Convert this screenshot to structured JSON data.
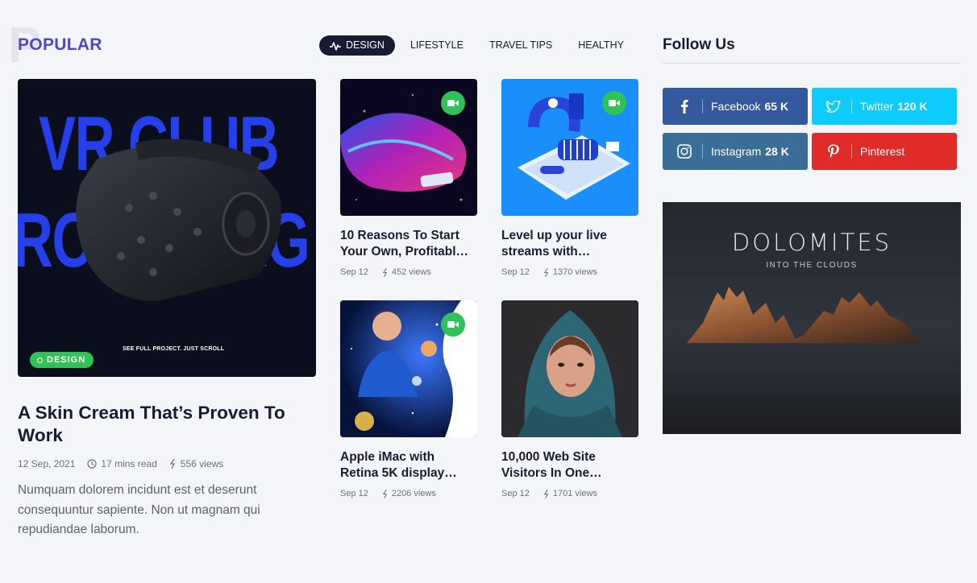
{
  "section": {
    "bg_letter": "P",
    "title": "POPULAR"
  },
  "tabs": [
    {
      "label": "DESIGN",
      "active": true
    },
    {
      "label": "LIFESTYLE",
      "active": false
    },
    {
      "label": "TRAVEL TIPS",
      "active": false
    },
    {
      "label": "HEALTHY",
      "active": false
    }
  ],
  "featured": {
    "image_text_line1": "VR CLUB",
    "image_text_line2": "ROMO PAG",
    "image_caption": "SEE FULL PROJECT. JUST SCROLL",
    "category": "DESIGN",
    "title": "A Skin Cream That’s Proven To Work",
    "date": "12 Sep, 2021",
    "read_time": "17 mins read",
    "views": "556 views",
    "excerpt": "Numquam dolorem incidunt est et deserunt consequuntur sapiente. Non ut magnam qui repudiandae laborum."
  },
  "cards": [
    {
      "title_line1": "10 Reasons To Start",
      "title_line2": "Your Own, Profitabl…",
      "date": "Sep 12",
      "views": "452 views"
    },
    {
      "title_line1": "Level up your live",
      "title_line2": "streams with…",
      "date": "Sep 12",
      "views": "1370 views"
    },
    {
      "title_line1": "Apple iMac with",
      "title_line2": "Retina 5K display…",
      "date": "Sep 12",
      "views": "2206 views"
    },
    {
      "title_line1": "10,000 Web Site",
      "title_line2": "Visitors In One…",
      "date": "Sep 12",
      "views": "1701 views"
    }
  ],
  "follow": {
    "title": "Follow Us",
    "networks": [
      {
        "name": "Facebook",
        "count": "65 K",
        "color": "#35599e",
        "icon": "facebook-icon"
      },
      {
        "name": "Twitter",
        "count": "120 K",
        "color": "#0dcbfc",
        "icon": "twitter-icon"
      },
      {
        "name": "Instagram",
        "count": "28 K",
        "color": "#3b6e96",
        "icon": "instagram-icon"
      },
      {
        "name": "Pinterest",
        "count": "",
        "color": "#e12b28",
        "icon": "pinterest-icon"
      }
    ]
  },
  "ad": {
    "title": "DOLOMITES",
    "subtitle": "INTO THE CLOUDS"
  },
  "colors": {
    "accent": "#5146c9",
    "dark": "#181c32",
    "green": "#2fc256",
    "background": "#f4f5f9"
  }
}
